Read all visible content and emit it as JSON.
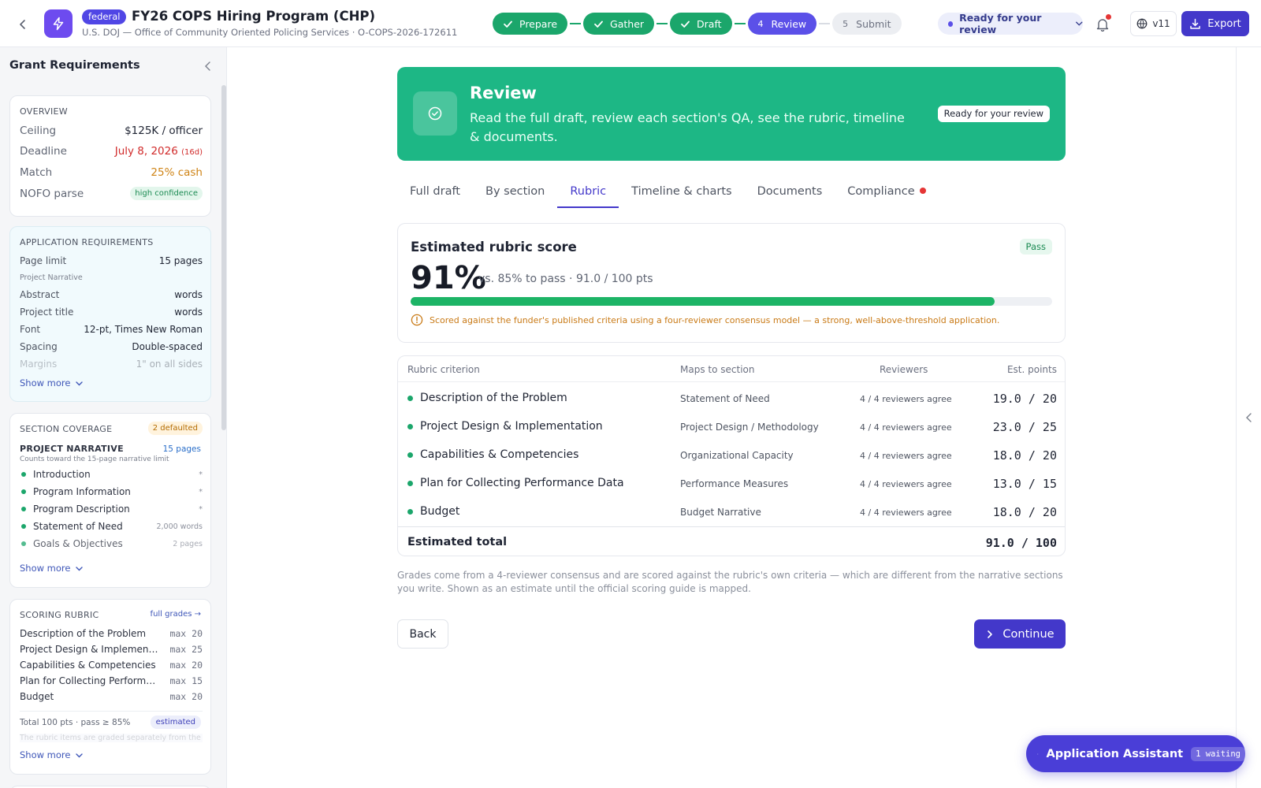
{
  "header": {
    "program_type": "federal",
    "title": "FY26 COPS Hiring Program (CHP)",
    "subtitle": "U.S. DOJ — Office of Community Oriented Policing Services · O-COPS-2026-172611",
    "steps": [
      {
        "num": "1",
        "label": "Prepare",
        "state": "done"
      },
      {
        "num": "2",
        "label": "Gather",
        "state": "done"
      },
      {
        "num": "3",
        "label": "Draft",
        "state": "done"
      },
      {
        "num": "4",
        "label": "Review",
        "state": "current"
      },
      {
        "num": "5",
        "label": "Submit",
        "state": "todo"
      }
    ],
    "status": "Ready for your review",
    "version": "v11",
    "export_label": "Export"
  },
  "sidebar": {
    "title": "Grant Requirements",
    "overview": {
      "heading": "OVERVIEW",
      "ceiling_label": "Ceiling",
      "ceiling_value": "$125K / officer",
      "deadline_label": "Deadline",
      "deadline_value": "July 8, 2026",
      "deadline_days": "(16d)",
      "match_label": "Match",
      "match_value": "25% cash",
      "nofo_label": "NOFO parse",
      "nofo_value": "high confidence"
    },
    "app_requirements": {
      "heading": "APPLICATION REQUIREMENTS",
      "page_limit_label": "Page limit",
      "page_limit_value": "15 pages",
      "page_limit_note": "Project Narrative",
      "abstract_label": "Abstract",
      "abstract_value": "words",
      "project_title_label": "Project title",
      "project_title_value": "words",
      "font_label": "Font",
      "font_value": "12-pt, Times New Roman",
      "spacing_label": "Spacing",
      "spacing_value": "Double-spaced",
      "margins_label": "Margins",
      "margins_value": "1\" on all sides",
      "show_more": "Show more"
    },
    "section_coverage": {
      "heading": "SECTION COVERAGE",
      "defaulted": "2 defaulted",
      "narrative_title": "PROJECT NARRATIVE",
      "narrative_pages": "15 pages",
      "narrative_note": "Counts toward the 15-page narrative limit",
      "items": [
        {
          "label": "Introduction",
          "meta": "*"
        },
        {
          "label": "Program Information",
          "meta": "*"
        },
        {
          "label": "Program Description",
          "meta": "*"
        },
        {
          "label": "Statement of Need",
          "meta": "2,000 words"
        },
        {
          "label": "Goals & Objectives",
          "meta": "2 pages"
        }
      ],
      "show_more": "Show more"
    },
    "scoring_rubric": {
      "heading": "SCORING RUBRIC",
      "full_grades": "full grades →",
      "items": [
        {
          "name": "Description of the Problem",
          "max": "max 20"
        },
        {
          "name": "Project Design & Implementation",
          "max": "max 25"
        },
        {
          "name": "Capabilities & Competencies",
          "max": "max 20"
        },
        {
          "name": "Plan for Collecting Performance Data",
          "max": "max 15"
        },
        {
          "name": "Budget",
          "max": "max 20"
        }
      ],
      "total": "Total 100 pts · pass ≥ 85%",
      "estimated": "estimated",
      "fade_note": "The rubric items are graded separately from the",
      "show_more": "Show more"
    }
  },
  "hero": {
    "title": "Review",
    "description": "Read the full draft, review each section's QA, see the rubric, timeline & documents.",
    "status": "Ready for your review"
  },
  "tabs": [
    {
      "label": "Full draft",
      "active": false
    },
    {
      "label": "By section",
      "active": false
    },
    {
      "label": "Rubric",
      "active": true
    },
    {
      "label": "Timeline & charts",
      "active": false
    },
    {
      "label": "Documents",
      "active": false
    },
    {
      "label": "Compliance",
      "active": false,
      "alert": true
    }
  ],
  "score": {
    "title": "Estimated rubric score",
    "status": "Pass",
    "percent": "91%",
    "fill_fraction": 0.91,
    "comparison": "vs. 85% to pass · 91.0 / 100 pts",
    "note": "Scored against the funder's published criteria using a four-reviewer consensus model — a strong, well-above-threshold application."
  },
  "rubric_table": {
    "headers": {
      "criterion": "Rubric criterion",
      "section": "Maps to section",
      "reviewers": "Reviewers",
      "points": "Est. points"
    },
    "rows": [
      {
        "criterion": "Description of the Problem",
        "section": "Statement of Need",
        "reviewers": "4 / 4 reviewers agree",
        "points": "19.0 / 20"
      },
      {
        "criterion": "Project Design & Implementation",
        "section": "Project Design / Methodology",
        "reviewers": "4 / 4 reviewers agree",
        "points": "23.0 / 25"
      },
      {
        "criterion": "Capabilities & Competencies",
        "section": "Organizational Capacity",
        "reviewers": "4 / 4 reviewers agree",
        "points": "18.0 / 20"
      },
      {
        "criterion": "Plan for Collecting Performance Data",
        "section": "Performance Measures",
        "reviewers": "4 / 4 reviewers agree",
        "points": "13.0 / 15"
      },
      {
        "criterion": "Budget",
        "section": "Budget Narrative",
        "reviewers": "4 / 4 reviewers agree",
        "points": "18.0 / 20"
      }
    ],
    "total_label": "Estimated total",
    "total_value": "91.0 / 100"
  },
  "footnote": "Grades come from a 4-reviewer consensus and are scored against the rubric's own criteria — which are different from the narrative sections you write. Shown as an estimate until the official scoring guide is mapped.",
  "actions": {
    "back": "Back",
    "continue": "Continue"
  },
  "assistant": {
    "label": "Application Assistant",
    "badge": "1 waiting"
  },
  "colors": {
    "accent": "#4338ca",
    "success": "#1ba66b",
    "hero": "#1db785",
    "alert": "#e53535"
  }
}
